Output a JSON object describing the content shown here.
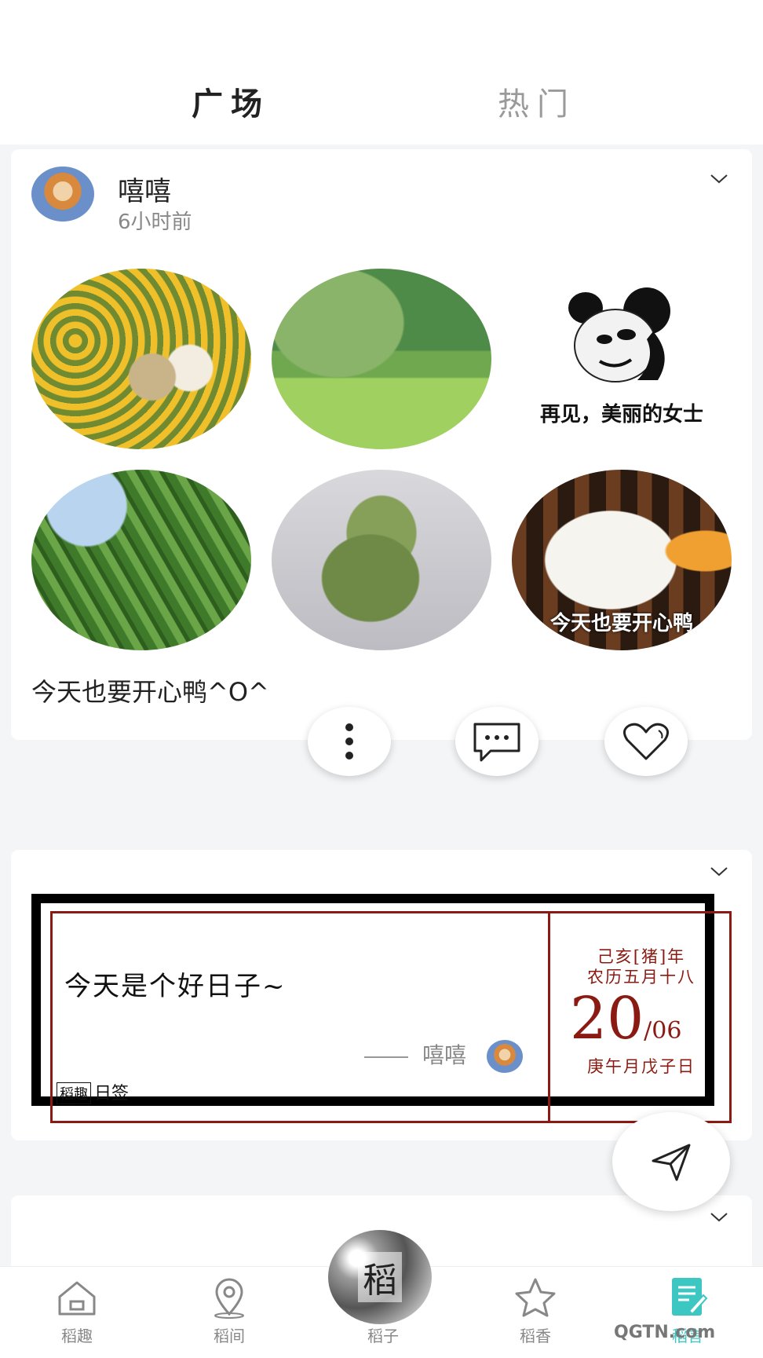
{
  "header": {
    "tabs": [
      {
        "label": "广场",
        "active": true
      },
      {
        "label": "热门",
        "active": false
      }
    ]
  },
  "post": {
    "username": "嘻嘻",
    "time": "6小时前",
    "images": [
      {
        "desc_icon": "sunflower-photo"
      },
      {
        "desc_icon": "rice-field-bicycle-photo"
      },
      {
        "desc_icon": "panda-meme-image",
        "caption": "再见，美丽的女士"
      },
      {
        "desc_icon": "tree-fruit-photo"
      },
      {
        "desc_icon": "zongzi-photo"
      },
      {
        "desc_icon": "duck-meme-image",
        "caption": "今天也要开心鸭"
      }
    ],
    "text": "今天也要开心鸭^O^"
  },
  "sign_card": {
    "quote": "今天是个好日子~",
    "author": "嘻嘻",
    "brand": "日签",
    "brand_logo": "稻趣",
    "lunar_year": "己亥[猪]年",
    "lunar_date": "农历五月十八",
    "day": "20",
    "month": "/06",
    "ganzhi": "庚午月戊子日"
  },
  "nav": {
    "items": [
      {
        "label": "稻趣",
        "icon": "home-icon"
      },
      {
        "label": "稻间",
        "icon": "location-pin-icon"
      },
      {
        "label": "稻子",
        "icon": "center-logo-icon",
        "logo_text": "稻"
      },
      {
        "label": "稻香",
        "icon": "star-icon"
      },
      {
        "label": "稻言",
        "icon": "note-edit-icon"
      }
    ],
    "active_color": "#3cc7c2"
  },
  "watermark": "QGTN.com"
}
